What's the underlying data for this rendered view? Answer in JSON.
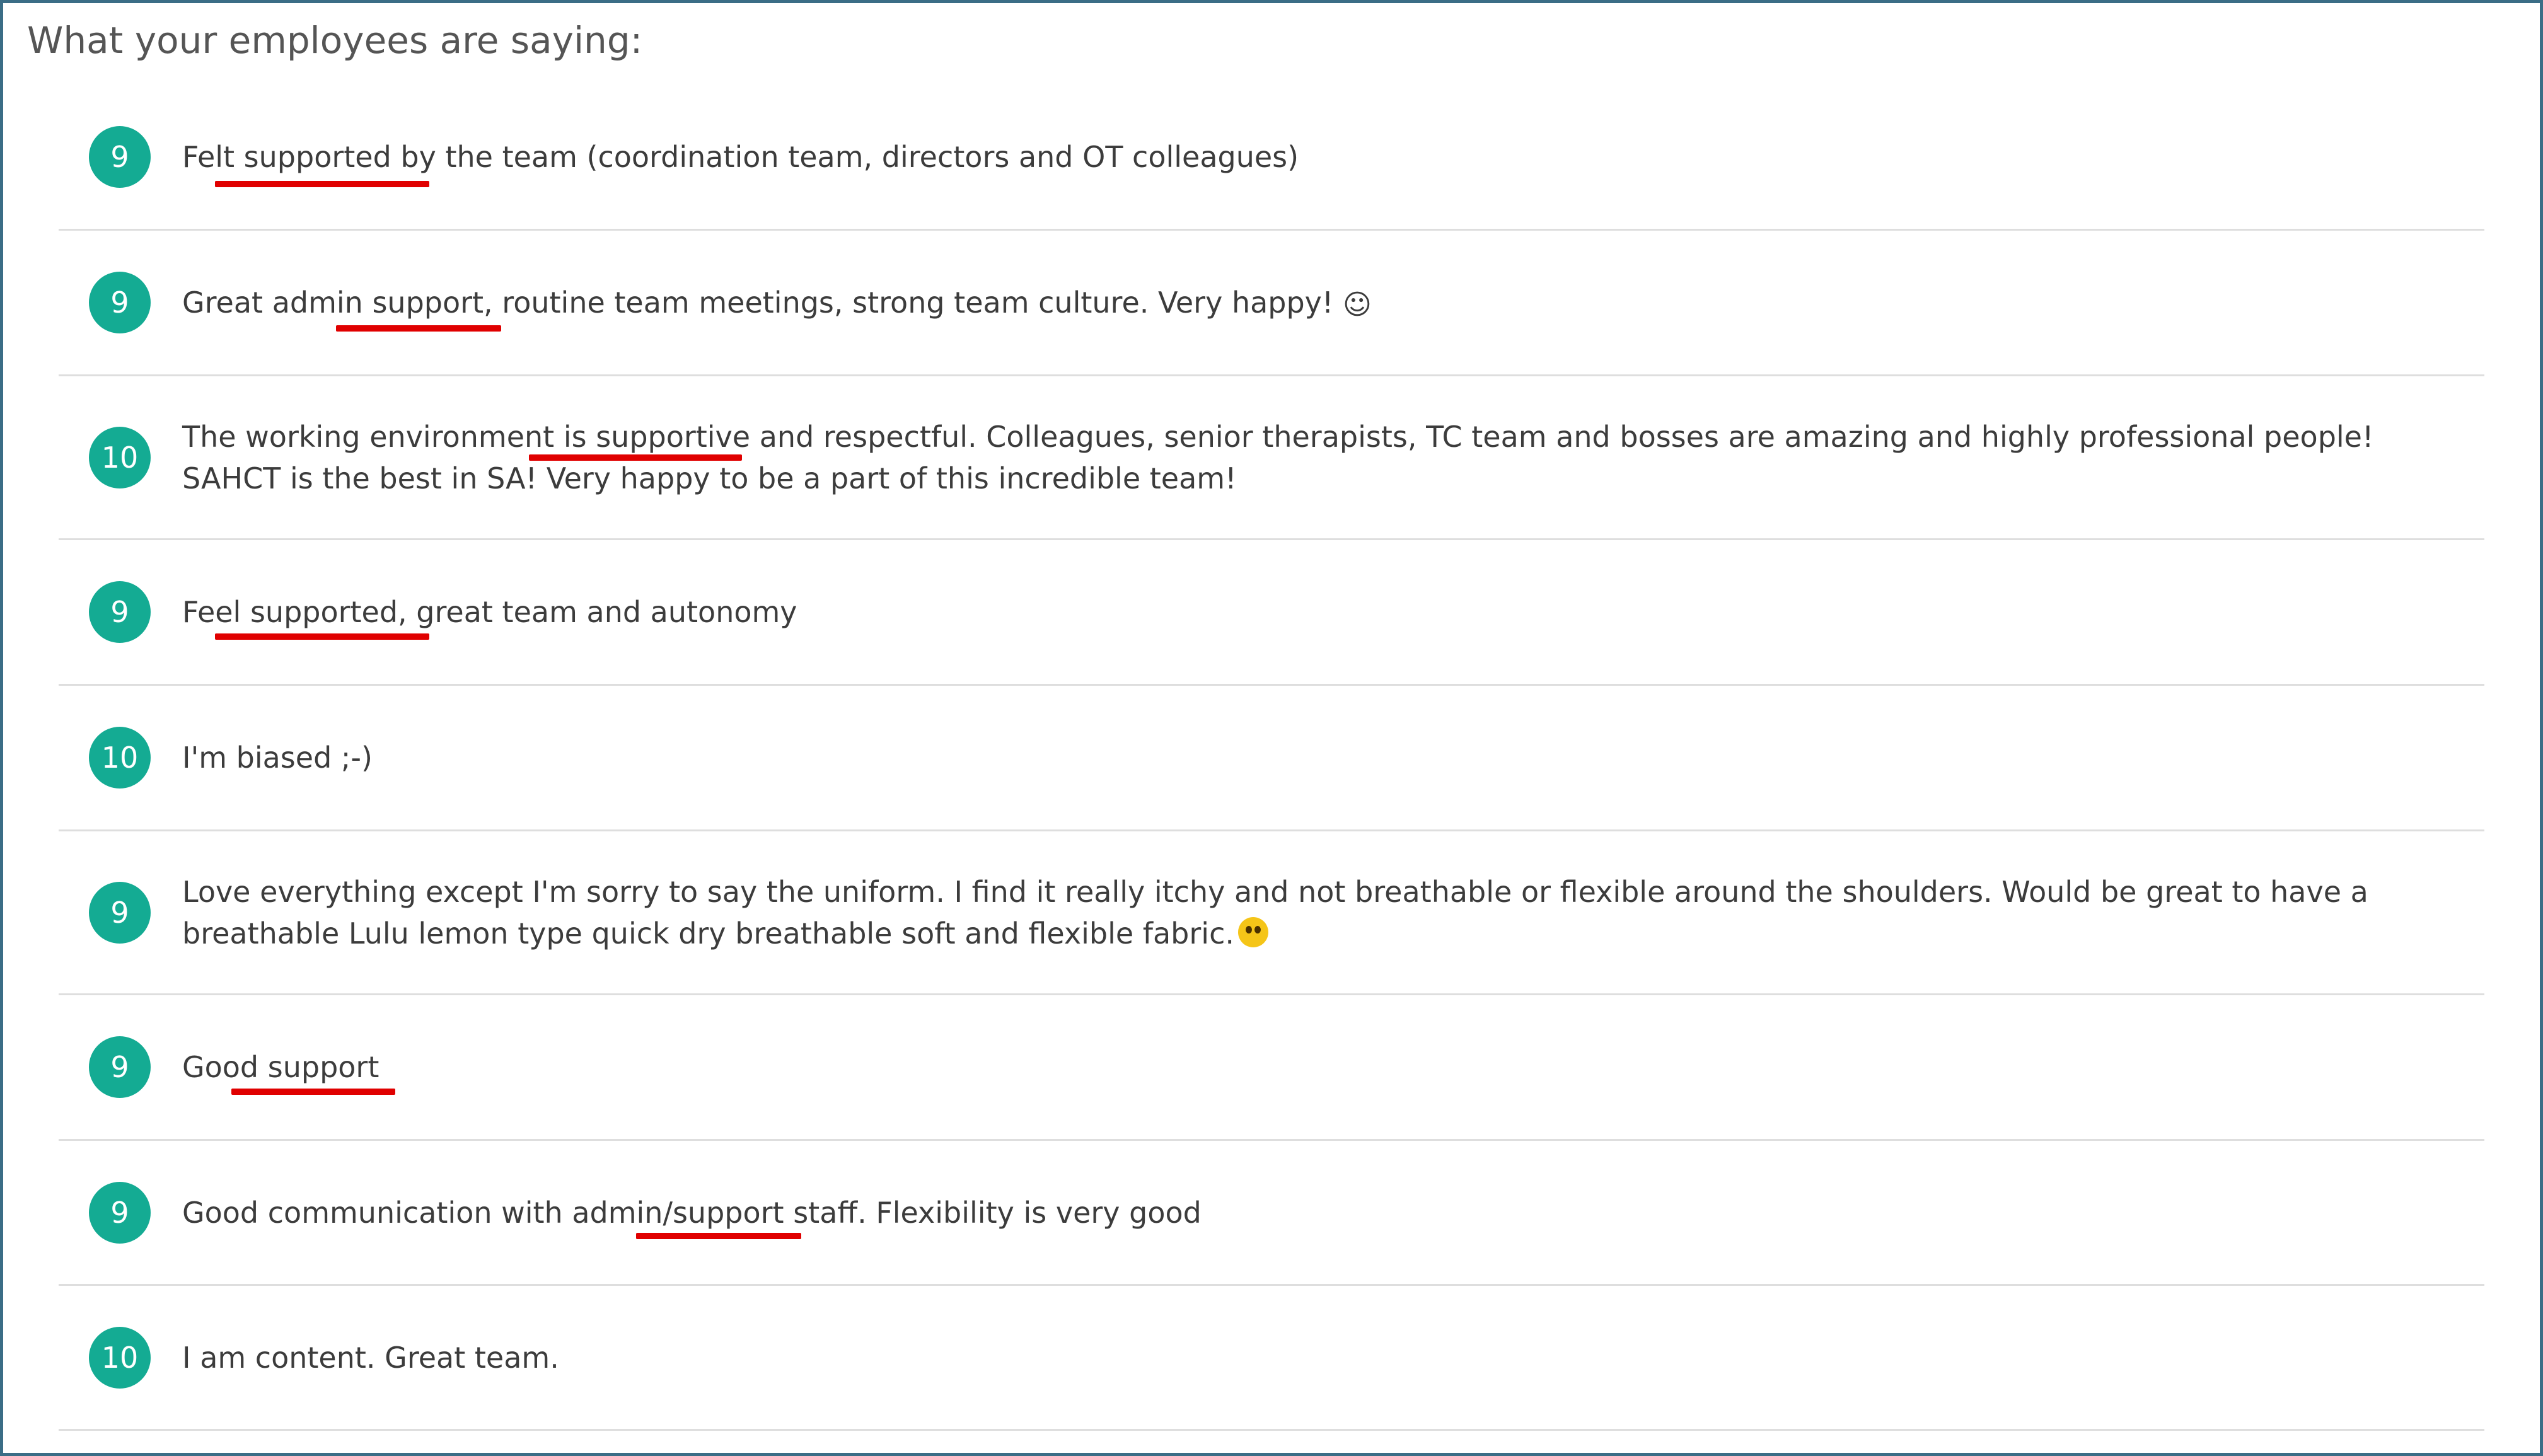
{
  "heading": "What your employees are saying:",
  "colors": {
    "score_badge": "#14ab93",
    "underline": "#e00000",
    "frame_border": "#3b6d86"
  },
  "responses": [
    {
      "score": "9",
      "comment": "Felt supported by the team (coordination team, directors and OT colleagues)"
    },
    {
      "score": "9",
      "comment": "Great admin support, routine team meetings, strong team culture. Very happy!",
      "emoji": "☺"
    },
    {
      "score": "10",
      "comment": "The working environment is supportive and respectful. Colleagues, senior therapists, TC team and bosses are amazing and highly professional people! SAHCT is the best in SA! Very happy to be a part of this incredible team!"
    },
    {
      "score": "9",
      "comment": "Feel supported, great team and autonomy"
    },
    {
      "score": "10",
      "comment": "I'm biased ;-)"
    },
    {
      "score": "9",
      "comment": "Love everything except I'm sorry to say the uniform. I find it really itchy and not breathable or flexible around the shoulders. Would be great to have a breathable Lulu lemon type quick dry breathable soft and flexible fabric.",
      "emoji_icon": "flushed-face-emoji-icon"
    },
    {
      "score": "9",
      "comment": "Good support"
    },
    {
      "score": "9",
      "comment": "Good communication with admin/support staff. Flexibility is very good"
    },
    {
      "score": "10",
      "comment": "I am content. Great team."
    }
  ]
}
